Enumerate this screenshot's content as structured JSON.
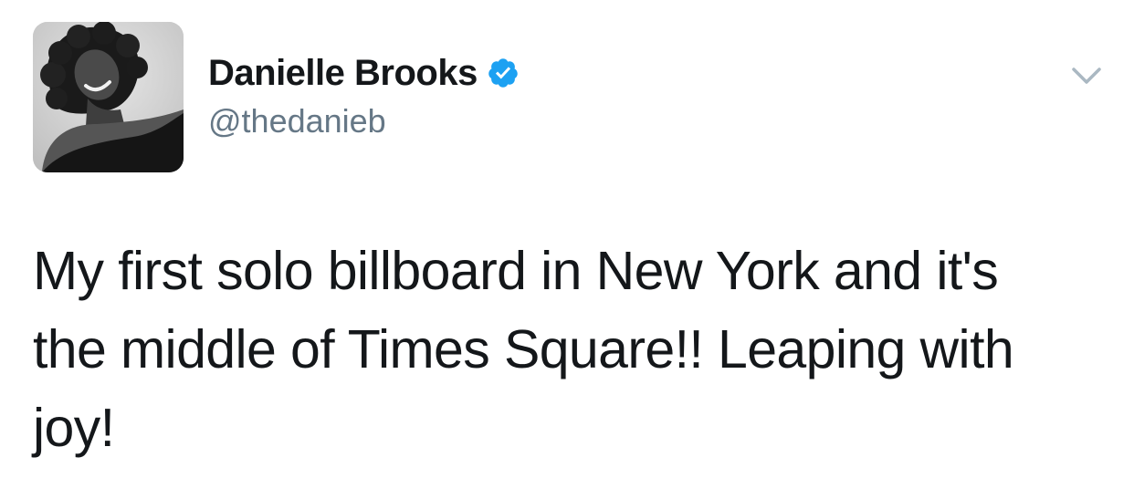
{
  "author": {
    "display_name": "Danielle Brooks",
    "handle": "@thedanieb",
    "verified": true
  },
  "tweet": {
    "text": "My first solo billboard in New York and it's\nthe middle of Times Square!! Leaping with\njoy!"
  },
  "icons": {
    "avatar": "profile-photo-avatar",
    "verified": "verified-badge-icon",
    "menu": "chevron-down-icon"
  },
  "colors": {
    "verified_blue": "#1da1f2",
    "handle_gray": "#657786",
    "chevron_gray": "#aab8c2",
    "text": "#14171a"
  }
}
